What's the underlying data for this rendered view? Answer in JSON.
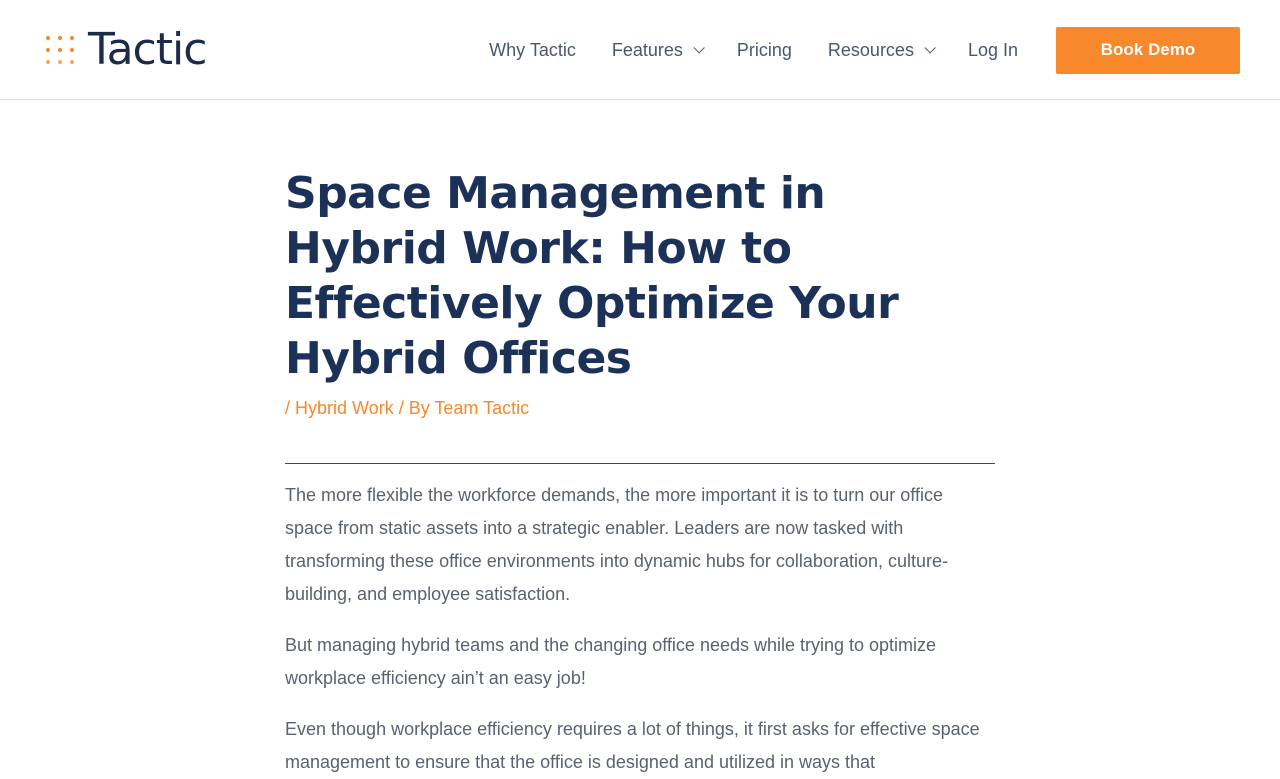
{
  "brand": {
    "name": "Tactic",
    "accent": "#f7882b",
    "text_color": "#1c2b4a"
  },
  "nav": {
    "items": [
      {
        "label": "Why Tactic",
        "has_dropdown": false
      },
      {
        "label": "Features",
        "has_dropdown": true
      },
      {
        "label": "Pricing",
        "has_dropdown": false
      },
      {
        "label": "Resources",
        "has_dropdown": true
      },
      {
        "label": "Log In",
        "has_dropdown": false
      }
    ],
    "cta_label": "Book Demo"
  },
  "article": {
    "title": "Space Management in Hybrid Work: How to Effectively Optimize Your Hybrid Offices",
    "meta": {
      "prefix": "/ ",
      "category": "Hybrid Work",
      "by": " / By ",
      "author": "Team Tactic"
    },
    "paragraphs": [
      "The more flexible the workforce demands, the more important it is to turn our office space from static assets into a strategic enabler. Leaders are now tasked with transforming these office environments into dynamic hubs for collaboration, culture-building, and employee satisfaction.",
      "But managing hybrid teams and the changing office needs while trying to optimize workplace efficiency ain’t an easy job!",
      "Even though workplace efficiency requires a lot of things, it first asks for effective space management to ensure that the office is designed and utilized in ways that"
    ]
  }
}
